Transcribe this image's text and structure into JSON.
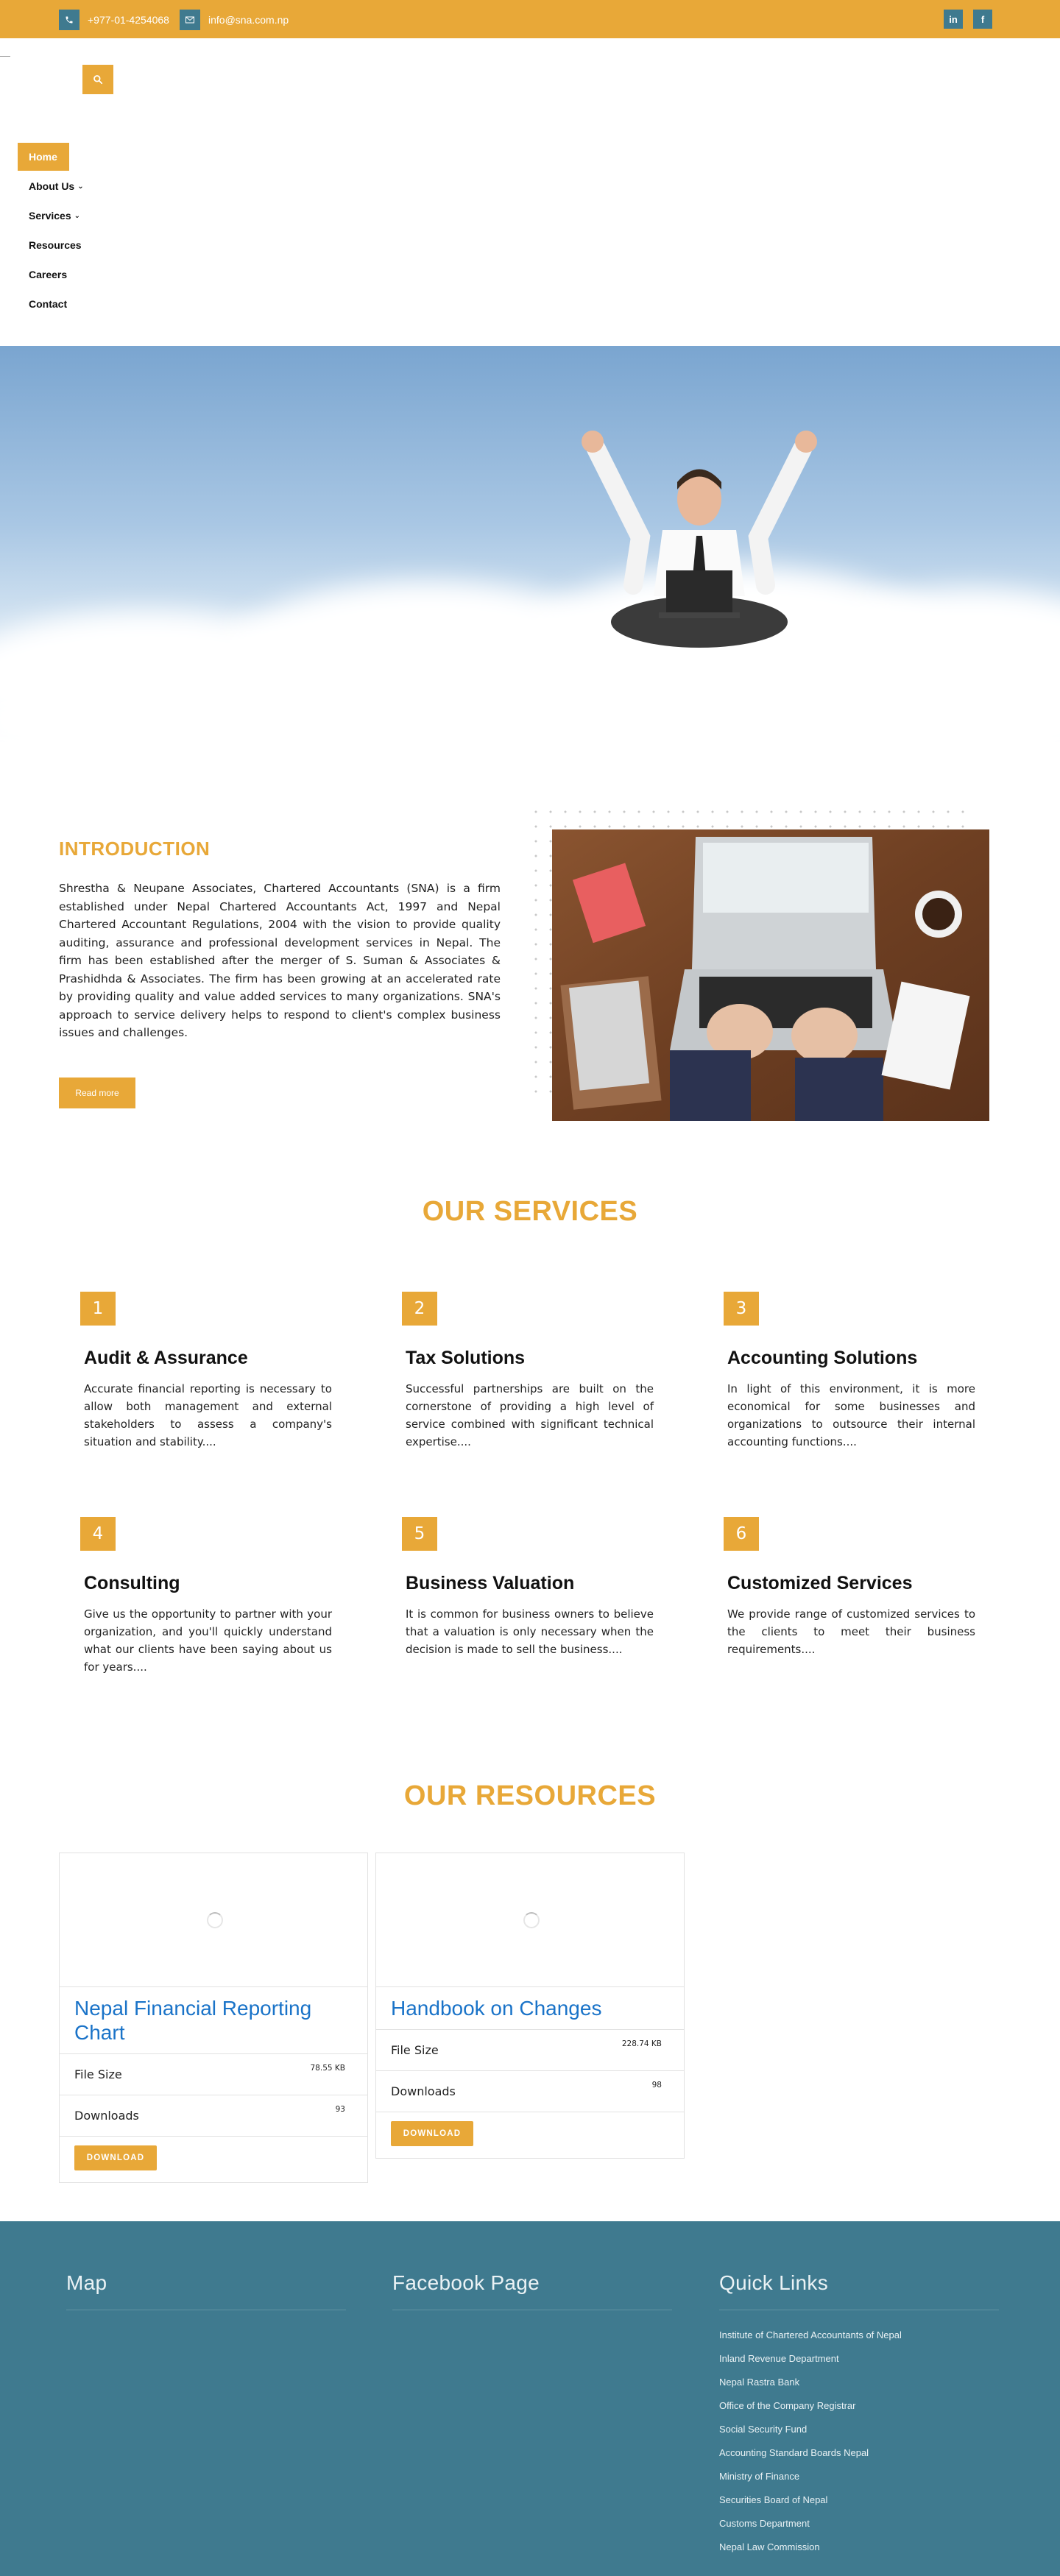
{
  "topbar": {
    "phone": "+977-01-4254068",
    "email": "info@sna.com.np",
    "phone_icon": "phone-icon",
    "email_icon": "envelope-icon",
    "social": [
      {
        "icon": "linkedin-icon",
        "glyph": "in"
      },
      {
        "icon": "facebook-icon",
        "glyph": "f"
      }
    ]
  },
  "header": {
    "search_icon": "search-icon"
  },
  "nav": [
    {
      "label": "Home",
      "active": true,
      "has_dropdown": false
    },
    {
      "label": "About Us",
      "active": false,
      "has_dropdown": true
    },
    {
      "label": "Services",
      "active": false,
      "has_dropdown": true
    },
    {
      "label": "Resources",
      "active": false,
      "has_dropdown": false
    },
    {
      "label": "Careers",
      "active": false,
      "has_dropdown": false
    },
    {
      "label": "Contact",
      "active": false,
      "has_dropdown": false
    }
  ],
  "hero": {
    "image": "businessman-on-cloud-with-laptop"
  },
  "intro": {
    "title": "INTRODUCTION",
    "text": "Shrestha & Neupane Associates, Chartered Accountants (SNA) is a firm established under Nepal Chartered Accountants Act, 1997 and Nepal Chartered Accountant Regulations, 2004 with the vision to provide quality auditing, assurance and professional development services in Nepal. The firm has been established after the merger of S. Suman & Associates & Prashidhda & Associates. The firm has been growing at an accelerated rate by providing quality and value added services to many organizations. SNA's approach to service delivery helps to respond to client's complex business issues and challenges.",
    "button": "Read more",
    "image": "desk-with-laptop-calculator"
  },
  "services": {
    "title": "OUR SERVICES",
    "items": [
      {
        "num": "1",
        "title": "Audit & Assurance",
        "text": "Accurate financial reporting is necessary to allow both management and external stakeholders to assess a company's situation and stability...."
      },
      {
        "num": "2",
        "title": "Tax Solutions",
        "text": "Successful partnerships are built on the cornerstone of providing a high level of service combined with significant technical expertise...."
      },
      {
        "num": "3",
        "title": "Accounting Solutions",
        "text": "In light of this environment, it is more economical for some businesses and organizations to outsource their internal accounting functions...."
      },
      {
        "num": "4",
        "title": "Consulting",
        "text": "Give us the opportunity to partner with your organization, and you'll quickly understand what our clients have been saying about us for years...."
      },
      {
        "num": "5",
        "title": "Business Valuation",
        "text": "It is common for business owners to believe that a valuation is only necessary when the decision is made to sell the business...."
      },
      {
        "num": "6",
        "title": "Customized Services",
        "text": "We provide range of customized services to the clients to meet their business requirements...."
      }
    ]
  },
  "resources": {
    "title": "OUR RESOURCES",
    "items": [
      {
        "title": "Nepal Financial Reporting Chart",
        "file_size_label": "File Size",
        "file_size": "78.55 KB",
        "downloads_label": "Downloads",
        "downloads": "93",
        "button": "DOWNLOAD"
      },
      {
        "title": "Handbook on Changes",
        "file_size_label": "File Size",
        "file_size": "228.74 KB",
        "downloads_label": "Downloads",
        "downloads": "98",
        "button": "DOWNLOAD"
      }
    ]
  },
  "footer": {
    "map_title": "Map",
    "facebook_title": "Facebook Page",
    "links_title": "Quick Links",
    "links": [
      "Institute of Chartered Accountants of Nepal",
      "Inland Revenue Department",
      "Nepal Rastra Bank",
      "Office of the Company Registrar",
      "Social Security Fund",
      "Accounting Standard Boards Nepal",
      "Ministry of Finance",
      "Securities Board of Nepal",
      "Customs Department",
      "Nepal Law Commission"
    ]
  },
  "colors": {
    "accent": "#e8a838",
    "teal": "#3f7a8f",
    "link_blue": "#1a73c8"
  }
}
